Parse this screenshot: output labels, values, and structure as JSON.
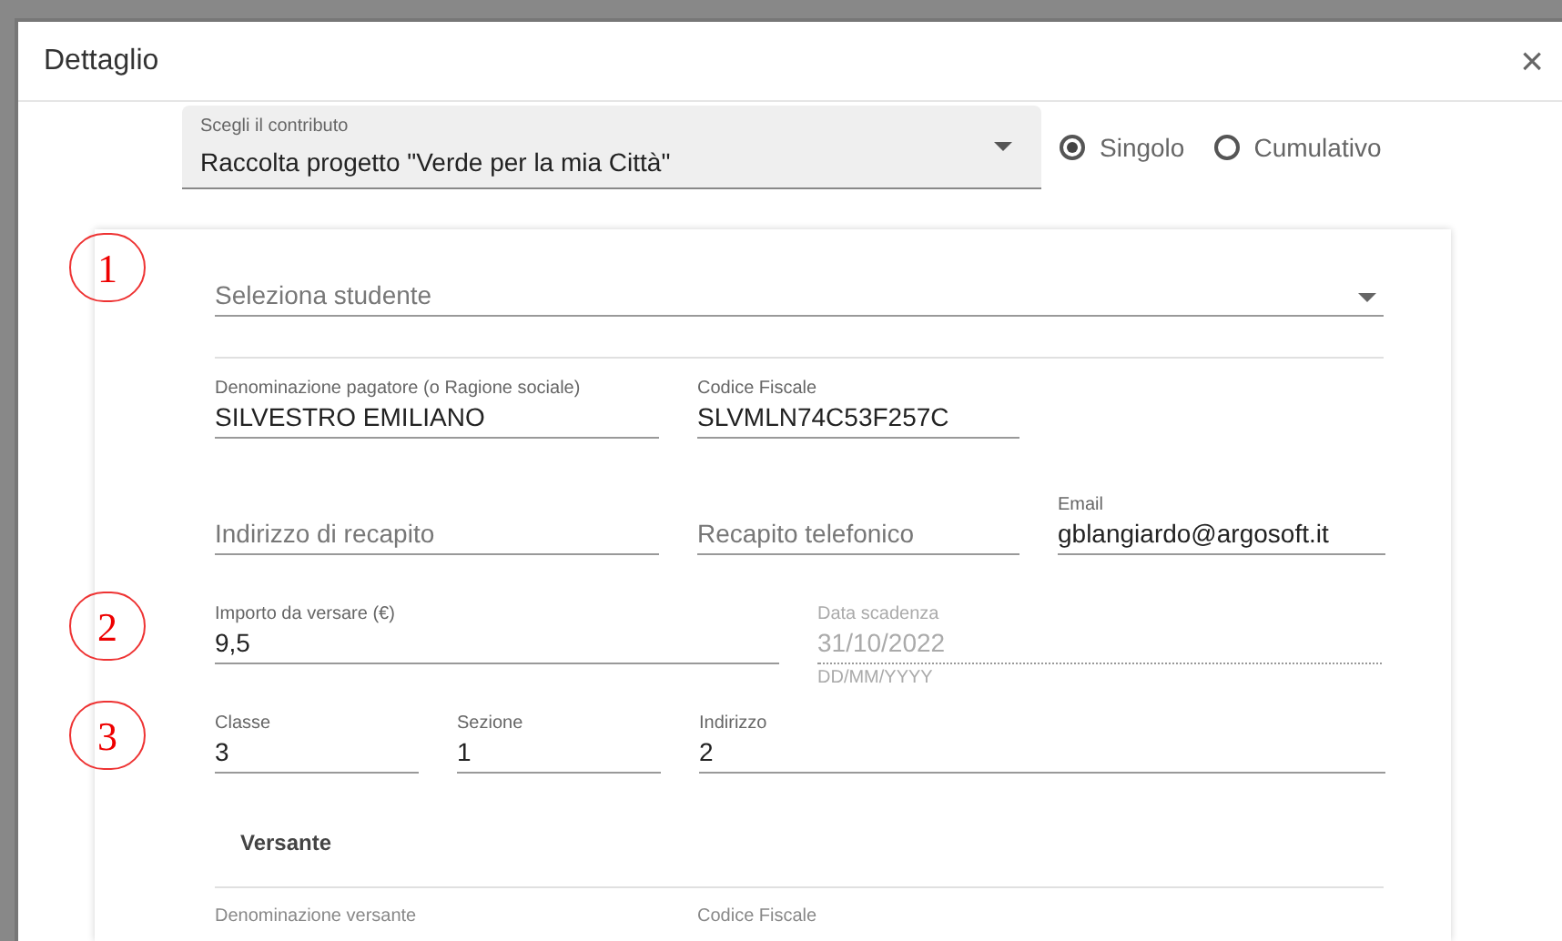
{
  "dialog": {
    "title": "Dettaglio",
    "close": "×"
  },
  "contribution": {
    "label": "Scegli il contributo",
    "value": "Raccolta progetto \"Verde per la mia Città\""
  },
  "mode_options": [
    {
      "label": "Singolo",
      "selected": true
    },
    {
      "label": "Cumulativo",
      "selected": false
    }
  ],
  "sections": [
    {
      "marker": "1",
      "rows": [
        [
          {
            "kind": "select",
            "placeholder": "Seleziona studente"
          }
        ],
        [
          {
            "kind": "text",
            "label": "Denominazione pagatore (o Ragione sociale)",
            "value": "SILVESTRO EMILIANO"
          },
          {
            "kind": "text",
            "label": "Codice Fiscale",
            "value": "SLVMLN74C53F257C"
          }
        ],
        [
          {
            "kind": "text",
            "placeholder": "Indirizzo di recapito"
          },
          {
            "kind": "text",
            "placeholder": "Recapito telefonico"
          },
          {
            "kind": "text",
            "label": "Email",
            "value": "gblangiardo@argosoft.it"
          }
        ]
      ]
    },
    {
      "marker": "2",
      "rows": [
        [
          {
            "kind": "text",
            "label": "Importo da versare (€)",
            "value": "9,5"
          },
          {
            "kind": "date",
            "label": "Data scadenza",
            "value": "31/10/2022",
            "helper": "DD/MM/YYYY",
            "disabled": true
          }
        ]
      ]
    },
    {
      "marker": "3",
      "rows": [
        [
          {
            "kind": "text",
            "label": "Classe",
            "value": "3"
          },
          {
            "kind": "text",
            "label": "Sezione",
            "value": "1"
          },
          {
            "kind": "text",
            "label": "Indirizzo",
            "value": "2"
          }
        ]
      ]
    }
  ],
  "versante": {
    "heading": "Versante",
    "labels": [
      "Denominazione versante",
      "Codice Fiscale"
    ]
  }
}
